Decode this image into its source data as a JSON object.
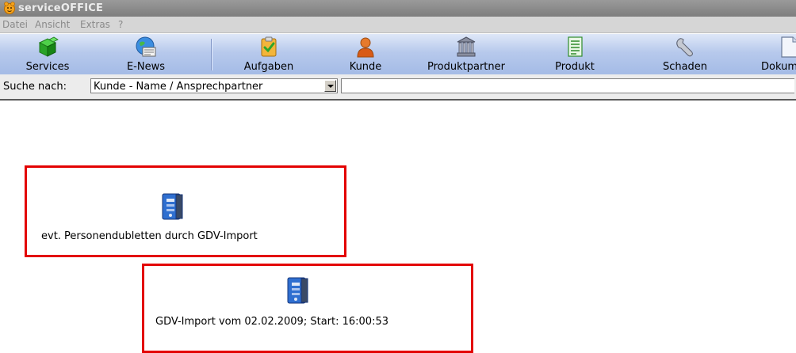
{
  "window": {
    "title": "serviceOFFICE",
    "icon": "app-logo-icon"
  },
  "menu": [
    "Datei",
    "Ansicht",
    "Extras",
    "?"
  ],
  "toolbar": {
    "buttons": [
      {
        "label": "Services",
        "icon": "services-cube-icon"
      },
      {
        "label": "E-News",
        "icon": "globe-news-icon"
      },
      {
        "label": "Aufgaben",
        "icon": "task-clipboard-icon"
      },
      {
        "label": "Kunde",
        "icon": "customer-person-icon"
      },
      {
        "label": "Produktpartner",
        "icon": "bank-building-icon"
      },
      {
        "label": "Produkt",
        "icon": "product-sheet-icon"
      },
      {
        "label": "Schaden",
        "icon": "wrench-icon"
      },
      {
        "label": "Dokume",
        "icon": "document-icon"
      }
    ]
  },
  "search": {
    "label": "Suche nach:",
    "mode": "Kunde - Name / Ansprechpartner",
    "value": ""
  },
  "jobs": [
    {
      "label": "evt. Personendubletten durch GDV-Import",
      "icon": "binder-icon",
      "highlight_color": "#e30000"
    },
    {
      "label": "GDV-Import vom 02.02.2009; Start: 16:00:53",
      "icon": "binder-icon",
      "highlight_color": "#e30000"
    }
  ]
}
